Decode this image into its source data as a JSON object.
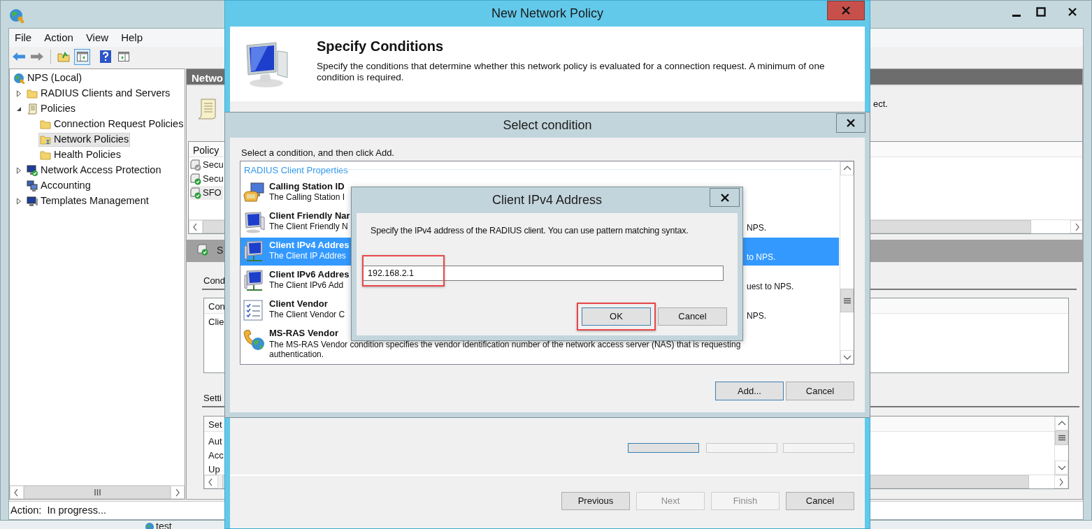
{
  "main_window": {
    "menu": [
      {
        "label": "File"
      },
      {
        "label": "Action"
      },
      {
        "label": "View"
      },
      {
        "label": "Help"
      }
    ],
    "tree": [
      {
        "label": "NPS (Local)",
        "kind": "globe",
        "selected": false,
        "children": [
          {
            "label": "RADIUS Clients and Servers",
            "kind": "folder",
            "selected": false,
            "expanded": false
          },
          {
            "label": "Policies",
            "kind": "scroll",
            "selected": false,
            "expanded": true,
            "children": [
              {
                "label": "Connection Request Policies",
                "kind": "folder",
                "selected": false
              },
              {
                "label": "Network Policies",
                "kind": "badge",
                "selected": true
              },
              {
                "label": "Health Policies",
                "kind": "folder",
                "selected": false
              }
            ]
          },
          {
            "label": "Network Access Protection",
            "kind": "computer",
            "selected": false,
            "expanded": false
          },
          {
            "label": "Accounting",
            "kind": "computers",
            "selected": false
          },
          {
            "label": "Templates Management",
            "kind": "monitor",
            "selected": false,
            "expanded": false
          }
        ]
      }
    ],
    "details": {
      "header": "Netwo",
      "banner_tail": "ect.",
      "policy_column": "Policy",
      "policies": [
        {
          "name": "Secu",
          "enabled": false,
          "selected": false
        },
        {
          "name": "Secu",
          "enabled": true,
          "selected": false
        },
        {
          "name": "SFO",
          "enabled": true,
          "selected": true
        }
      ],
      "section_title": "S",
      "conditions_label": "Cond",
      "conditions_column": "Con",
      "conditions_rows": [
        "Clie"
      ],
      "settings_label": "Setti",
      "settings_column": "Set",
      "settings_rows": [
        "Aut",
        "Acc",
        "Up"
      ]
    },
    "status_bar": "Action:  In progress..."
  },
  "background_item": "test",
  "wizard": {
    "title": "New Network Policy",
    "heading": "Specify Conditions",
    "description": "Specify the conditions that determine whether this network policy is evaluated for a connection request. A minimum of one condition is required.",
    "buttons": [
      {
        "label": "Previous",
        "disabled": false
      },
      {
        "label": "Next",
        "disabled": true
      },
      {
        "label": "Finish",
        "disabled": true
      },
      {
        "label": "Cancel",
        "disabled": false
      }
    ]
  },
  "select_condition": {
    "title": "Select condition",
    "instruction": "Select a condition, and then click Add.",
    "group": "RADIUS Client Properties",
    "conditions": [
      {
        "name": "Calling Station ID",
        "description": "The Calling Station I",
        "kind": "phone",
        "selected": false
      },
      {
        "name": "Client Friendly Nar",
        "description": "The Client Friendly N",
        "description_tail": "NPS.",
        "kind": "monitor",
        "selected": false
      },
      {
        "name": "Client IPv4 Addres",
        "description": "The Client IP Addres",
        "description_tail": "to NPS.",
        "kind": "network",
        "selected": true
      },
      {
        "name": "Client IPv6 Addres",
        "description": "The Client IPv6 Add",
        "description_tail": "uest to NPS.",
        "kind": "network",
        "selected": false
      },
      {
        "name": "Client Vendor",
        "description": "The Client Vendor C",
        "description_tail": "NPS.",
        "kind": "checklist",
        "selected": false
      },
      {
        "name": "MS-RAS Vendor",
        "description": "The MS-RAS Vendor condition specifies the vendor identification number of the network access server (NAS) that is requesting authentication.",
        "kind": "globe",
        "selected": false
      }
    ],
    "buttons": [
      {
        "label": "Add...",
        "default": true
      },
      {
        "label": "Cancel",
        "default": false
      }
    ]
  },
  "ipv4_dialog": {
    "title": "Client IPv4 Address",
    "prompt": "Specify the IPv4 address of the RADIUS client. You can use pattern matching syntax.",
    "field": {
      "value": "192.168.2.1",
      "highlighted": true
    },
    "buttons": [
      {
        "label": "OK",
        "default": true,
        "highlighted": true
      },
      {
        "label": "Cancel",
        "default": false,
        "highlighted": false
      }
    ]
  }
}
